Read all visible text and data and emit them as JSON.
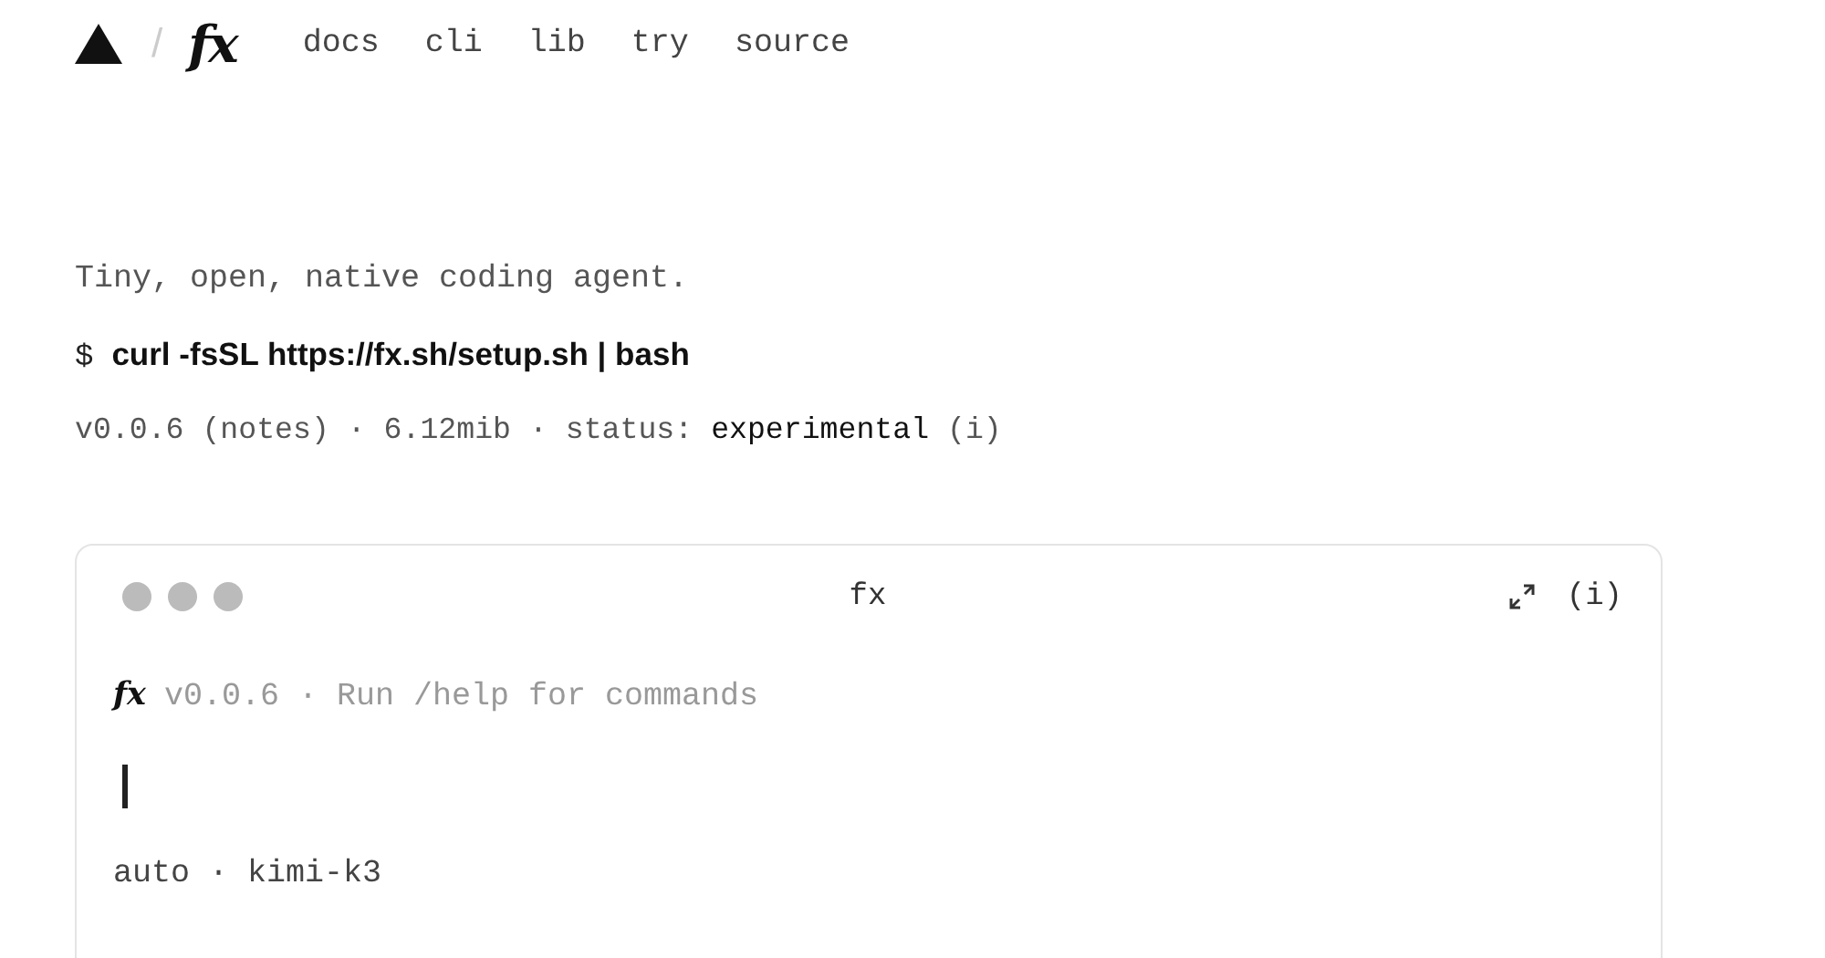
{
  "header": {
    "logo_slash": "/",
    "logo": "fx",
    "nav": [
      {
        "label": "docs"
      },
      {
        "label": "cli"
      },
      {
        "label": "lib"
      },
      {
        "label": "try"
      },
      {
        "label": "source"
      }
    ]
  },
  "tagline": "Tiny, open, native coding agent.",
  "install": {
    "prompt": "$",
    "command": "curl -fsSL https://fx.sh/setup.sh | bash"
  },
  "meta": [
    {
      "text": "v0.0.6",
      "kind": "plain"
    },
    {
      "text": "(notes)",
      "kind": "link"
    },
    {
      "text": "·",
      "kind": "plain"
    },
    {
      "text": "6.12mib",
      "kind": "plain"
    },
    {
      "text": "·",
      "kind": "plain"
    },
    {
      "text": "status:",
      "kind": "plain"
    },
    {
      "text": "experimental",
      "kind": "strong"
    },
    {
      "text": "(i)",
      "kind": "link"
    }
  ],
  "terminal": {
    "title": "fx",
    "info": "(i)",
    "brand": "fx",
    "banner": "v0.0.6 · Run /help for commands",
    "status": "auto · kimi-k3"
  }
}
